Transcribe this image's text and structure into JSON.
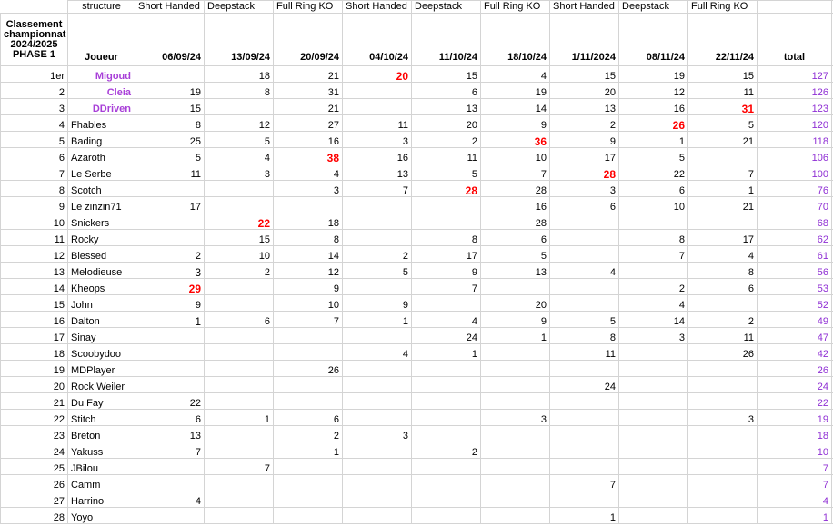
{
  "sheet": {
    "title_lines": "Classement championnat 2024/2025 PHASE 1",
    "structure_label": "structure",
    "player_header": "Joueur",
    "total_header": "total",
    "accent_top_player": "#a83fd8",
    "accent_total": "#8f2fd4",
    "accent_highlight": "#ff0000",
    "grid_color": "#d4d4d4"
  },
  "columns": [
    {
      "structure": "Short Handed",
      "date": "06/09/24"
    },
    {
      "structure": "Deepstack",
      "date": "13/09/24"
    },
    {
      "structure": "Full Ring KO",
      "date": "20/09/24"
    },
    {
      "structure": "Short Handed",
      "date": "04/10/24"
    },
    {
      "structure": "Deepstack",
      "date": "11/10/24"
    },
    {
      "structure": "Full Ring KO",
      "date": "18/10/24"
    },
    {
      "structure": "Short Handed",
      "date": "1/11/2024"
    },
    {
      "structure": "Deepstack",
      "date": "08/11/24"
    },
    {
      "structure": "Full Ring KO",
      "date": "22/11/24"
    }
  ],
  "rows": [
    {
      "rank": "1er",
      "player": "Migoud",
      "top": true,
      "values": [
        "",
        "18",
        "21",
        "20*",
        "15",
        "4",
        "15",
        "19",
        "15"
      ],
      "total": "127"
    },
    {
      "rank": "2",
      "player": "Cleia",
      "top": true,
      "values": [
        "19",
        "8",
        "31",
        "",
        "6",
        "19",
        "20",
        "12",
        "11"
      ],
      "total": "126"
    },
    {
      "rank": "3",
      "player": "DDriven",
      "top": true,
      "values": [
        "15",
        "",
        "21",
        "",
        "13",
        "14",
        "13",
        "16",
        "31*"
      ],
      "total": "123"
    },
    {
      "rank": "4",
      "player": "Fhables",
      "top": false,
      "values": [
        "8",
        "12",
        "27",
        "11",
        "20",
        "9",
        "2",
        "26*",
        "5"
      ],
      "total": "120"
    },
    {
      "rank": "5",
      "player": "Bading",
      "top": false,
      "values": [
        "25",
        "5",
        "16",
        "3",
        "2",
        "36*",
        "9",
        "1",
        "21"
      ],
      "total": "118"
    },
    {
      "rank": "6",
      "player": "Azaroth",
      "top": false,
      "values": [
        "5",
        "4",
        "38*",
        "16",
        "11",
        "10",
        "17",
        "5",
        ""
      ],
      "total": "106"
    },
    {
      "rank": "7",
      "player": "Le Serbe",
      "top": false,
      "values": [
        "11",
        "3",
        "4",
        "13",
        "5",
        "7",
        "28*",
        "22",
        "7"
      ],
      "total": "100"
    },
    {
      "rank": "8",
      "player": "Scotch",
      "top": false,
      "values": [
        "",
        "",
        "3",
        "7",
        "28*",
        "28",
        "3",
        "6",
        "1"
      ],
      "total": "76"
    },
    {
      "rank": "9",
      "player": "Le zinzin71",
      "top": false,
      "values": [
        "17",
        "",
        "",
        "",
        "",
        "16",
        "6",
        "10",
        "21"
      ],
      "total": "70"
    },
    {
      "rank": "10",
      "player": "Snickers",
      "top": false,
      "values": [
        "",
        "22*",
        "18",
        "",
        "",
        "28",
        "",
        "",
        ""
      ],
      "total": "68"
    },
    {
      "rank": "11",
      "player": "Rocky",
      "top": false,
      "values": [
        "",
        "15",
        "8",
        "",
        "8",
        "6",
        "",
        "8",
        "17"
      ],
      "total": "62"
    },
    {
      "rank": "12",
      "player": "Blessed",
      "top": false,
      "values": [
        "2",
        "10",
        "14",
        "2",
        "17",
        "5",
        "",
        "7",
        "4"
      ],
      "total": "61"
    },
    {
      "rank": "13",
      "player": "Melodieuse",
      "top": false,
      "values": [
        "3^",
        "2",
        "12",
        "5",
        "9",
        "13",
        "4",
        "",
        "8"
      ],
      "total": "56"
    },
    {
      "rank": "14",
      "player": "Kheops",
      "top": false,
      "values": [
        "29*",
        "",
        "9",
        "",
        "7",
        "",
        "",
        "2",
        "6"
      ],
      "total": "53"
    },
    {
      "rank": "15",
      "player": "John",
      "top": false,
      "values": [
        "9",
        "",
        "10",
        "9",
        "",
        "20",
        "",
        "4",
        ""
      ],
      "total": "52"
    },
    {
      "rank": "16",
      "player": "Dalton",
      "top": false,
      "values": [
        "1^",
        "6",
        "7",
        "1",
        "4",
        "9",
        "5",
        "14",
        "2"
      ],
      "total": "49"
    },
    {
      "rank": "17",
      "player": "Sinay",
      "top": false,
      "values": [
        "",
        "",
        "",
        "",
        "24",
        "1",
        "8",
        "3",
        "11"
      ],
      "total": "47"
    },
    {
      "rank": "18",
      "player": "Scoobydoo",
      "top": false,
      "values": [
        "",
        "",
        "",
        "4",
        "1",
        "",
        "11",
        "",
        "26"
      ],
      "total": "42"
    },
    {
      "rank": "19",
      "player": "MDPlayer",
      "top": false,
      "values": [
        "",
        "",
        "26",
        "",
        "",
        "",
        "",
        "",
        ""
      ],
      "total": "26"
    },
    {
      "rank": "20",
      "player": "Rock Weiler",
      "top": false,
      "values": [
        "",
        "",
        "",
        "",
        "",
        "",
        "24",
        "",
        ""
      ],
      "total": "24"
    },
    {
      "rank": "21",
      "player": "Du Fay",
      "top": false,
      "values": [
        "22",
        "",
        "",
        "",
        "",
        "",
        "",
        "",
        ""
      ],
      "total": "22"
    },
    {
      "rank": "22",
      "player": "Stitch",
      "top": false,
      "values": [
        "6",
        "1",
        "6",
        "",
        "",
        "3",
        "",
        "",
        "3"
      ],
      "total": "19"
    },
    {
      "rank": "23",
      "player": "Breton",
      "top": false,
      "values": [
        "13",
        "",
        "2",
        "3",
        "",
        "",
        "",
        "",
        ""
      ],
      "total": "18"
    },
    {
      "rank": "24",
      "player": "Yakuss",
      "top": false,
      "values": [
        "7",
        "",
        "1",
        "",
        "2",
        "",
        "",
        "",
        ""
      ],
      "total": "10"
    },
    {
      "rank": "25",
      "player": "JBilou",
      "top": false,
      "values": [
        "",
        "7",
        "",
        "",
        "",
        "",
        "",
        "",
        ""
      ],
      "total": "7"
    },
    {
      "rank": "26",
      "player": "Camm",
      "top": false,
      "values": [
        "",
        "",
        "",
        "",
        "",
        "",
        "7",
        "",
        ""
      ],
      "total": "7"
    },
    {
      "rank": "27",
      "player": "Harrino",
      "top": false,
      "values": [
        "4",
        "",
        "",
        "",
        "",
        "",
        "",
        "",
        ""
      ],
      "total": "4"
    },
    {
      "rank": "28",
      "player": "Yoyo",
      "top": false,
      "values": [
        "",
        "",
        "",
        "",
        "",
        "",
        "1",
        "",
        ""
      ],
      "total": "1"
    }
  ]
}
